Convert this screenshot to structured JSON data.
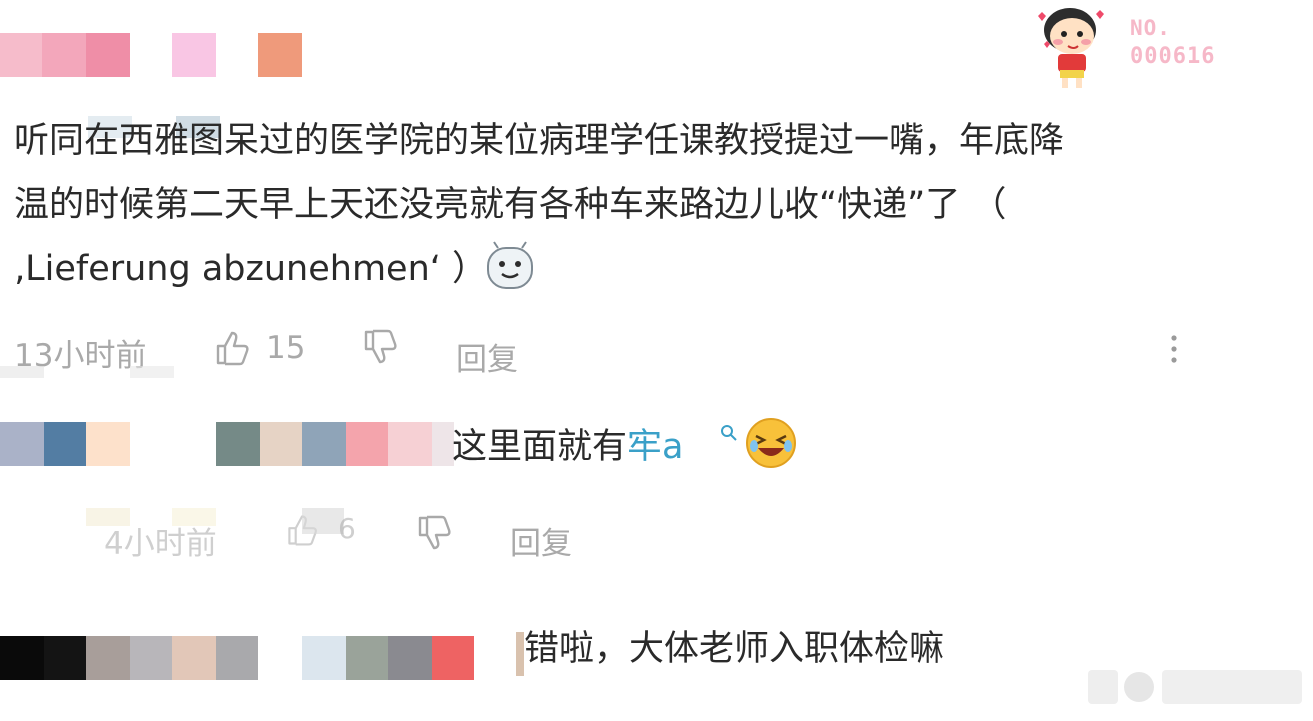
{
  "watermark": {
    "line1": "NO.",
    "line2": "000616"
  },
  "comments": [
    {
      "text_lines": [
        "听同在西雅图呆过的医学院的某位病理学任课教授提过一嘴，年底降",
        "温的时候第二天早上天还没亮就有各种车来路边儿收“快递”了 （",
        "‚Lieferung abzunehmen‘ ）"
      ],
      "time": "13小时前",
      "likes": "15",
      "reply_label": "回复",
      "more_icon": "more-vertical-icon"
    },
    {
      "text_prefix": "这里面就有",
      "text_link": "牢a",
      "time": "4小时前",
      "likes": "6",
      "reply_label": "回复"
    },
    {
      "text": "错啦，大体老师入职体检嘛"
    }
  ],
  "colors": {
    "link": "#3aa0c8",
    "meta": "#a9a9a9",
    "text": "#2a2a2a"
  }
}
